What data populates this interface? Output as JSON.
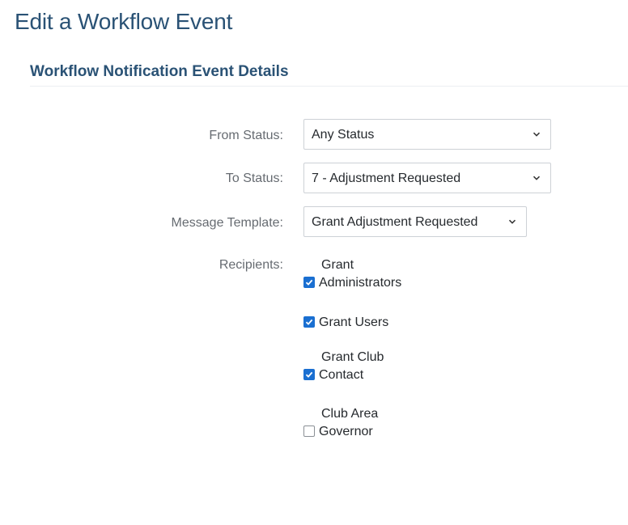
{
  "page": {
    "title": "Edit a Workflow Event",
    "section_title": "Workflow Notification Event Details"
  },
  "form": {
    "from_status": {
      "label": "From Status:",
      "value": "Any Status"
    },
    "to_status": {
      "label": "To Status:",
      "value": "7 - Adjustment Requested"
    },
    "message_template": {
      "label": "Message Template:",
      "value": "Grant Adjustment Requested"
    },
    "recipients": {
      "label": "Recipients:",
      "options": [
        {
          "line1": "Grant",
          "line2": "Administrators",
          "checked": true
        },
        {
          "line1": "",
          "line2": "Grant Users",
          "checked": true
        },
        {
          "line1": "Grant Club",
          "line2": "Contact",
          "checked": true
        },
        {
          "line1": "Club Area",
          "line2": "Governor",
          "checked": false
        }
      ]
    }
  },
  "colors": {
    "heading": "#2a5275",
    "label": "#666b71",
    "checkbox_checked": "#1a6fd1"
  },
  "icons": {
    "select_arrow": "chevron-down-icon",
    "check": "check-icon"
  }
}
